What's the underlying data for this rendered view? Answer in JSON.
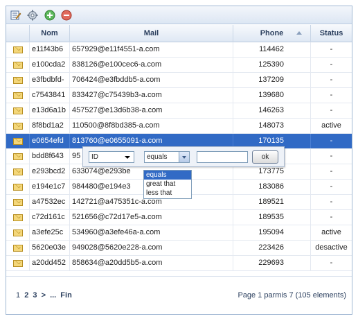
{
  "colors": {
    "selected_row": "#316ac5",
    "header_text": "#2b3f5e",
    "border": "#9fb6d2"
  },
  "toolbar": {
    "buttons": [
      {
        "icon": "edit-icon"
      },
      {
        "icon": "settings-icon"
      },
      {
        "icon": "add-icon"
      },
      {
        "icon": "remove-icon"
      }
    ]
  },
  "columns": {
    "nom": "Nom",
    "mail": "Mail",
    "phone": "Phone",
    "status": "Status"
  },
  "rows": [
    {
      "nom": "e11f43b6",
      "mail": "657929@e11f4551-a.com",
      "phone": "114462",
      "status": "-"
    },
    {
      "nom": "e100cda2",
      "mail": "838126@e100cec6-a.com",
      "phone": "125390",
      "status": "-"
    },
    {
      "nom": "e3fbdbfd-",
      "mail": "706424@e3fbddb5-a.com",
      "phone": "137209",
      "status": "-"
    },
    {
      "nom": "c7543841",
      "mail": "833427@c75439b3-a.com",
      "phone": "139680",
      "status": "-"
    },
    {
      "nom": "e13d6a1b",
      "mail": "457527@e13d6b38-a.com",
      "phone": "146263",
      "status": "-"
    },
    {
      "nom": "8f8bd1a2",
      "mail": "110500@8f8bd385-a.com",
      "phone": "148073",
      "status": "active"
    },
    {
      "nom": "e0654efd",
      "mail": "813760@e0655091-a.com",
      "phone": "170135",
      "status": "-"
    },
    {
      "nom": "bdd8f643",
      "mail": "95",
      "phone": "",
      "status": "-"
    },
    {
      "nom": "e293bcd2",
      "mail": "633074@e293be",
      "phone": "173775",
      "status": "-"
    },
    {
      "nom": "e194e1c7",
      "mail": "984480@e194e3",
      "phone": "183086",
      "status": "-"
    },
    {
      "nom": "a47532ec",
      "mail": "142721@a475351c-a.com",
      "phone": "189521",
      "status": "-"
    },
    {
      "nom": "c72d161c",
      "mail": "521656@c72d17e5-a.com",
      "phone": "189535",
      "status": "-"
    },
    {
      "nom": "a3efe25c",
      "mail": "534960@a3efe46a-a.com",
      "phone": "195094",
      "status": "active"
    },
    {
      "nom": "5620e03e",
      "mail": "949028@5620e228-a.com",
      "phone": "223426",
      "status": "desactive"
    },
    {
      "nom": "a20dd452",
      "mail": "858634@a20dd5b5-a.com",
      "phone": "229693",
      "status": "-"
    }
  ],
  "selected_row_index": 6,
  "filter": {
    "field": "ID",
    "operator": "equals",
    "value": "",
    "ok_label": "ok",
    "operator_options": [
      "equals",
      "great that",
      "less that"
    ]
  },
  "pager": {
    "current": "1",
    "pages": [
      "2",
      "3"
    ],
    "next": ">",
    "ellipsis": "...",
    "last": "Fin",
    "info": "Page 1 parmis 7 (105 elements)"
  }
}
